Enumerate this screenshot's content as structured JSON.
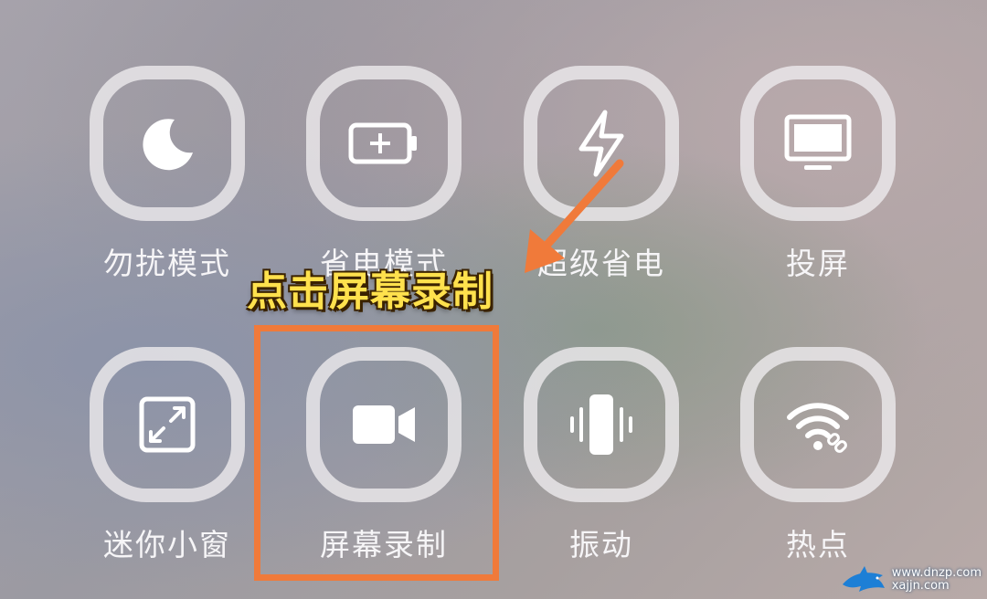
{
  "tiles": [
    {
      "label": "勿扰模式",
      "icon": "moon-icon"
    },
    {
      "label": "省电模式",
      "icon": "battery-plus-icon"
    },
    {
      "label": "超级省电",
      "icon": "lightning-icon"
    },
    {
      "label": "投屏",
      "icon": "monitor-icon"
    },
    {
      "label": "迷你小窗",
      "icon": "mini-window-icon"
    },
    {
      "label": "屏幕录制",
      "icon": "video-camera-icon"
    },
    {
      "label": "振动",
      "icon": "vibration-icon"
    },
    {
      "label": "热点",
      "icon": "wifi-hotspot-icon"
    }
  ],
  "annotation": {
    "callout": "点击屏幕录制",
    "highlight_color": "#f07a3a",
    "callout_color": "#ffe14d"
  },
  "watermark": {
    "site": "www.dnzp.com",
    "text": "xajjn.com"
  }
}
